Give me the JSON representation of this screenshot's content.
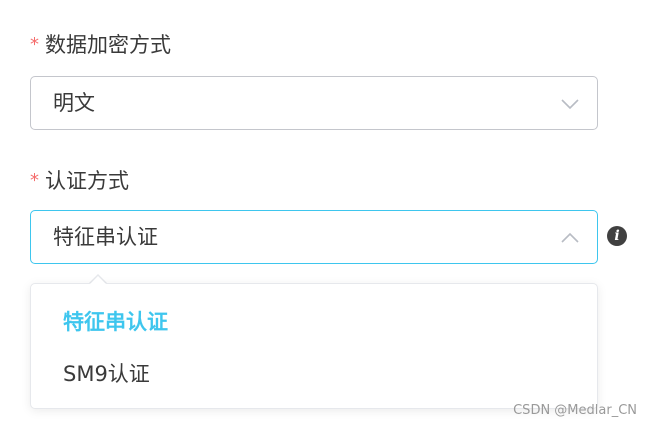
{
  "form": {
    "encryption": {
      "required_mark": "*",
      "label": "数据加密方式",
      "value": "明文",
      "icon": "chevron-down-icon"
    },
    "auth": {
      "required_mark": "*",
      "label": "认证方式",
      "value": "特征串认证",
      "icon": "chevron-up-icon",
      "info_icon": "info-icon",
      "info_glyph": "i",
      "options": [
        {
          "label": "特征串认证",
          "selected": true
        },
        {
          "label": "SM9认证",
          "selected": false
        }
      ]
    }
  },
  "colors": {
    "accent": "#3ec6ee",
    "required": "#f56c6c",
    "text": "#3a3a3a",
    "border": "#c4c6cc"
  },
  "watermark": "CSDN @Medlar_CN"
}
